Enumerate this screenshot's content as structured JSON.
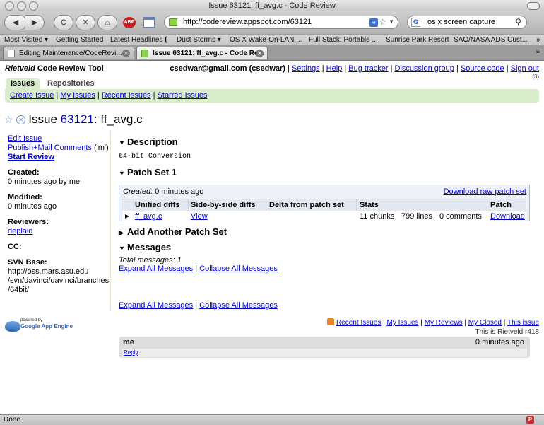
{
  "window": {
    "title": "Issue 63121: ff_avg.c - Code Review"
  },
  "toolbar": {
    "back": "◀",
    "forward": "▶",
    "reload": "C",
    "stop": "✕",
    "home": "⌂",
    "abp": "ABP",
    "url": "http://codereview.appspot.com/63121",
    "search_value": "os x screen capture",
    "search_engine": "G"
  },
  "bookmarks": [
    "Most Visited ▾",
    "Getting Started",
    "Latest Headlines ⦗",
    "Dust Storms ▾",
    "OS X Wake-On-LAN ...",
    "Full Stack: Portable ...",
    "Sunrise Park Resort",
    "SAO/NASA ADS Cust...",
    "»"
  ],
  "tabs": [
    {
      "label": "Editing Maintenance/CodeRevi..."
    },
    {
      "label": "Issue 63121: ff_avg.c - Code Re..."
    }
  ],
  "header": {
    "app_name": "Rietveld",
    "app_suffix": " Code Review Tool",
    "user": "csedwar@gmail.com (csedwar)",
    "links": [
      "Settings",
      "Help",
      "Bug tracker",
      "Discussion group",
      "Source code",
      "Sign out"
    ],
    "count": "(3)"
  },
  "section_tabs": {
    "issues": "Issues",
    "repositories": "Repositories"
  },
  "subnav": [
    "Create Issue",
    "My Issues",
    "Recent Issues",
    "Starred Issues"
  ],
  "issue": {
    "prefix": "Issue ",
    "number": "63121",
    "name": ": ff_avg.c"
  },
  "sidebar": {
    "edit": "Edit Issue",
    "publish": "Publish+Mail Comments",
    "publish_key": " ('m')",
    "start_review": "Start Review",
    "created_label": "Created:",
    "created_value": "0 minutes ago by me",
    "modified_label": "Modified:",
    "modified_value": "0 minutes ago",
    "reviewers_label": "Reviewers:",
    "reviewers_value": "deplaid",
    "cc_label": "CC:",
    "svn_label": "SVN Base:",
    "svn_line1": "http://oss.mars.asu.edu",
    "svn_line2": "/svn/davinci/davinci/branches",
    "svn_line3": "/64bit/"
  },
  "description": {
    "heading": "Description",
    "text": "64-bit Conversion"
  },
  "patchset": {
    "heading": "Patch Set 1",
    "created_label": "Created:",
    "created_value": " 0 minutes ago",
    "download_raw": "Download raw patch set",
    "columns": [
      "Unified diffs",
      "Side-by-side diffs",
      "Delta from patch set",
      "Stats",
      "Patch"
    ],
    "row": {
      "file": "ff_avg.c",
      "view": "View",
      "chunks": "11 chunks",
      "lines": "799 lines",
      "comments": "0 comments",
      "download": "Download"
    }
  },
  "add_patchset": {
    "heading": "Add Another Patch Set"
  },
  "messages": {
    "heading": "Messages",
    "total": "Total messages: 1",
    "expand": "Expand All Messages",
    "collapse": "Collapse All Messages",
    "author": "me",
    "time": "0 minutes ago",
    "reply": "Reply"
  },
  "footer": {
    "powered": "powered by",
    "engine": "Google App Engine",
    "links": [
      "Recent Issues",
      "My Issues",
      "My Reviews",
      "My Closed",
      "This issue"
    ],
    "version": "This is Rietveld r418"
  },
  "status": {
    "text": "Done",
    "icon": "P"
  }
}
